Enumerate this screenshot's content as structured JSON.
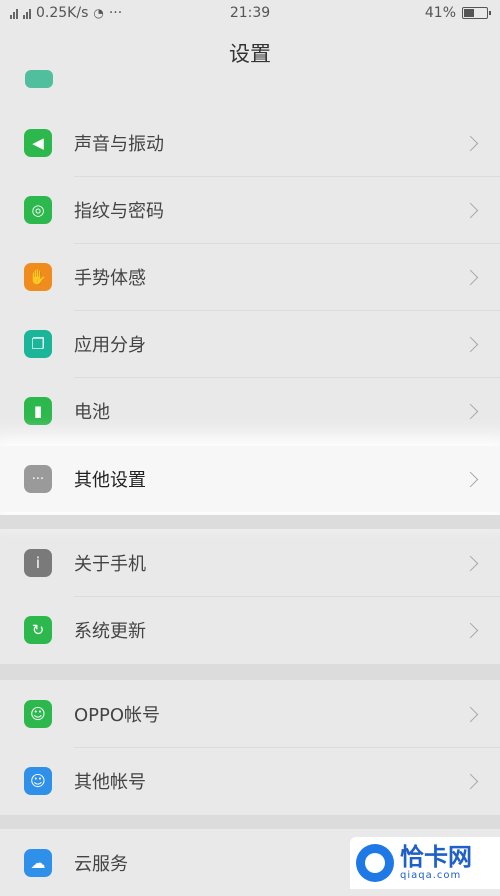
{
  "status_bar": {
    "left_text": "0.25K/s",
    "dots": "···",
    "time": "21:39",
    "battery_percent": "41%",
    "battery_level": 0.41
  },
  "header": {
    "title": "设置"
  },
  "rows": [
    {
      "label": "声音与振动",
      "icon": "speaker-icon",
      "color": "#2db84d",
      "glyph": "◀"
    },
    {
      "label": "指纹与密码",
      "icon": "fingerprint-icon",
      "color": "#2db84d",
      "glyph": "◎"
    },
    {
      "label": "手势体感",
      "icon": "gesture-icon",
      "color": "#f08c1e",
      "glyph": "✋"
    },
    {
      "label": "应用分身",
      "icon": "clone-icon",
      "color": "#1bb59a",
      "glyph": "❐"
    },
    {
      "label": "电池",
      "icon": "battery-icon",
      "color": "#2db84d",
      "glyph": "▮"
    },
    {
      "label": "其他设置",
      "icon": "more-icon",
      "color": "#9a9a9a",
      "glyph": "···"
    },
    {
      "label": "关于手机",
      "icon": "info-icon",
      "color": "#7a7a7a",
      "glyph": "i"
    },
    {
      "label": "系统更新",
      "icon": "update-icon",
      "color": "#2db84d",
      "glyph": "↻"
    },
    {
      "label": "OPPO帐号",
      "icon": "account-icon",
      "color": "#2db84d",
      "glyph": "☺"
    },
    {
      "label": "其他帐号",
      "icon": "user-icon",
      "color": "#2e90e8",
      "glyph": "☺"
    },
    {
      "label": "云服务",
      "icon": "cloud-icon",
      "color": "#2e90e8",
      "glyph": "☁"
    }
  ],
  "watermark": {
    "main": "恰卡网",
    "sub": "qiaqa.com"
  }
}
